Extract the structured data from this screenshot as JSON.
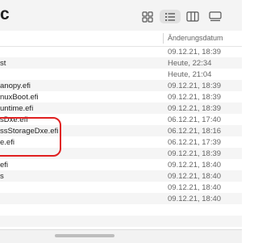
{
  "window": {
    "title": "c"
  },
  "toolbar": {
    "view_buttons": [
      "icons",
      "list",
      "columns",
      "gallery"
    ],
    "selected_view": "list"
  },
  "header": {
    "date_column": "Änderungsdatum"
  },
  "rows": [
    {
      "name": "",
      "date": "09.12.21, 18:39"
    },
    {
      "name": "st",
      "date": "Heute, 22:34"
    },
    {
      "name": "",
      "date": "Heute, 21:04"
    },
    {
      "name": "anopy.efi",
      "date": "09.12.21, 18:39"
    },
    {
      "name": "nuxBoot.efi",
      "date": "09.12.21, 18:39"
    },
    {
      "name": "untime.efi",
      "date": "09.12.21, 18:39"
    },
    {
      "name": "sDxe.efi",
      "date": "06.12.21, 17:40"
    },
    {
      "name": "ssStorageDxe.efi",
      "date": "06.12.21, 18:16"
    },
    {
      "name": "e.efi",
      "date": "06.12.21, 17:39"
    },
    {
      "name": "",
      "date": "09.12.21, 18:39"
    },
    {
      "name": "efi",
      "date": "09.12.21, 18:40"
    },
    {
      "name": "s",
      "date": "09.12.21, 18:40"
    },
    {
      "name": "",
      "date": "09.12.21, 18:40"
    },
    {
      "name": "",
      "date": "09.12.21, 18:40"
    },
    {
      "name": "",
      "date": ""
    },
    {
      "name": "",
      "date": ""
    }
  ],
  "colors": {
    "highlight": "#e02020",
    "stripe": "#f5f5f5",
    "selected_button": "#e1e1e1"
  }
}
